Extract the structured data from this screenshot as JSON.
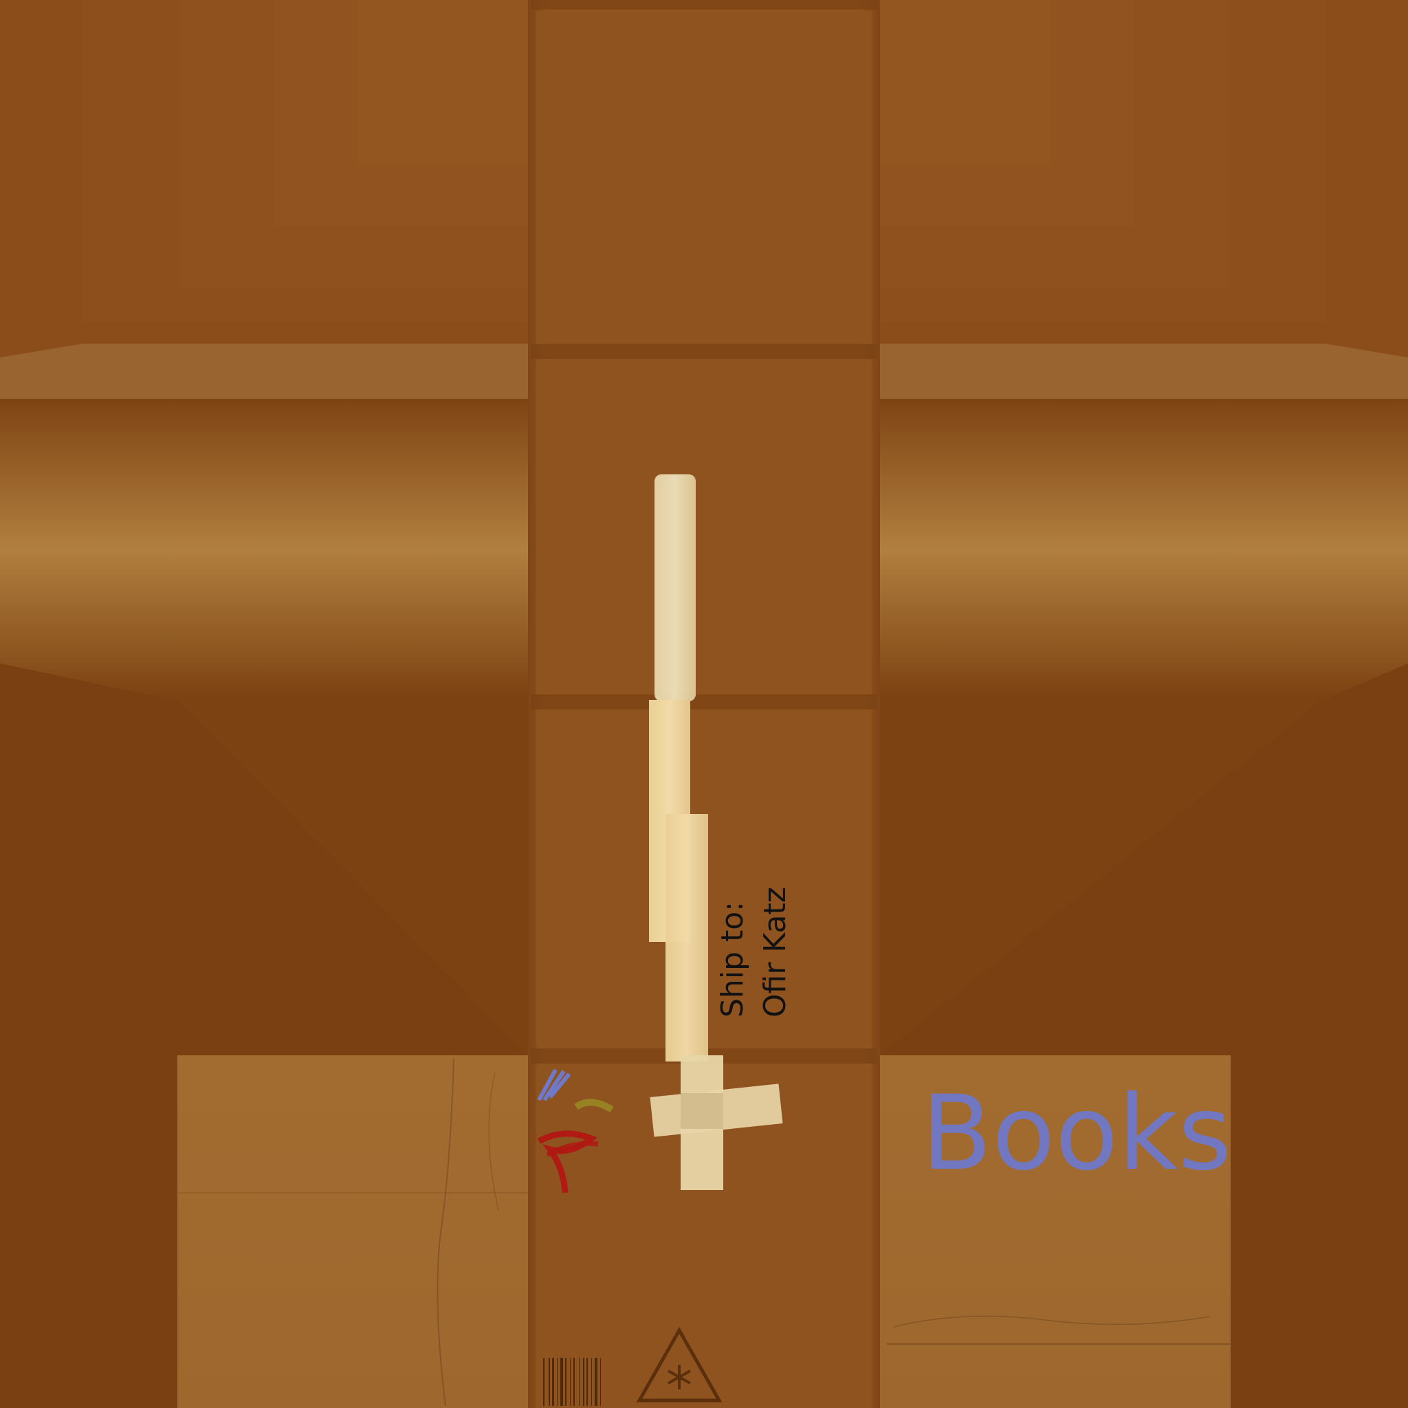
{
  "texture": {
    "colors": {
      "background": "#7d4212",
      "flap_dark": "#7b4011",
      "flap_light": "#b07f3f",
      "center_strip": "#8f5120",
      "panel_face": "#a0692f",
      "tape": "#e9d9ad",
      "tape_masking": "#eedcae",
      "ink_black": "#111111",
      "crayon_blue": "#6f79c9",
      "crayon_red": "#b01a12",
      "crayon_yellow": "#9a8a24"
    },
    "shipping_label": {
      "line1": "Ship to:",
      "line2": "Ofir Katz"
    },
    "side_label": {
      "text": "Books"
    },
    "icons": {
      "barcode": "barcode-icon",
      "fragile_warning": "snowflake-warning-icon",
      "crayon_marks": "crayon-scribble-icon"
    }
  }
}
